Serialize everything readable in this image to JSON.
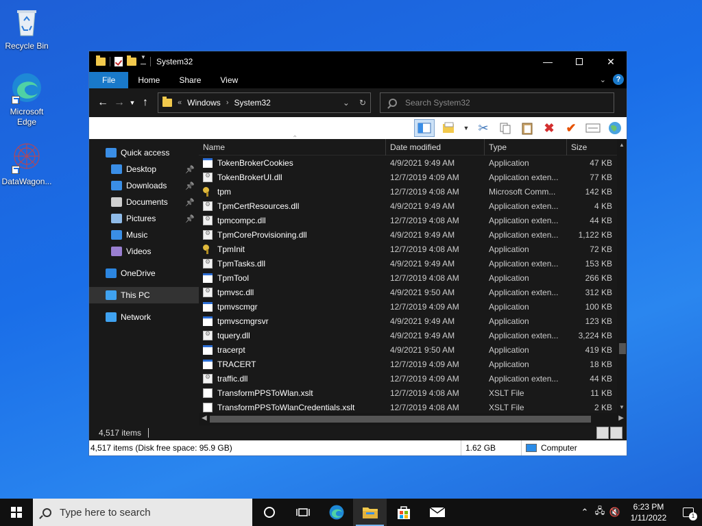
{
  "desktop": {
    "icons": [
      {
        "label": "Recycle Bin"
      },
      {
        "label": "Microsoft Edge"
      },
      {
        "label": "DataWagon..."
      }
    ]
  },
  "window": {
    "title": "System32",
    "ribbon_tabs": [
      "File",
      "Home",
      "Share",
      "View"
    ],
    "address": {
      "crumbs": [
        "Windows",
        "System32"
      ],
      "overflow": "«"
    },
    "search_placeholder": "Search System32",
    "columns": [
      "Name",
      "Date modified",
      "Type",
      "Size"
    ],
    "files": [
      {
        "name": "TokenBrokerCookies",
        "date": "4/9/2021 9:49 AM",
        "type": "Application",
        "size": "47 KB",
        "icon": "app"
      },
      {
        "name": "TokenBrokerUI.dll",
        "date": "12/7/2019 4:09 AM",
        "type": "Application exten...",
        "size": "77 KB",
        "icon": "dll"
      },
      {
        "name": "tpm",
        "date": "12/7/2019 4:08 AM",
        "type": "Microsoft Comm...",
        "size": "142 KB",
        "icon": "key"
      },
      {
        "name": "TpmCertResources.dll",
        "date": "4/9/2021 9:49 AM",
        "type": "Application exten...",
        "size": "4 KB",
        "icon": "dll"
      },
      {
        "name": "tpmcompc.dll",
        "date": "12/7/2019 4:08 AM",
        "type": "Application exten...",
        "size": "44 KB",
        "icon": "dll"
      },
      {
        "name": "TpmCoreProvisioning.dll",
        "date": "4/9/2021 9:49 AM",
        "type": "Application exten...",
        "size": "1,122 KB",
        "icon": "dll"
      },
      {
        "name": "TpmInit",
        "date": "12/7/2019 4:08 AM",
        "type": "Application",
        "size": "72 KB",
        "icon": "key"
      },
      {
        "name": "TpmTasks.dll",
        "date": "4/9/2021 9:49 AM",
        "type": "Application exten...",
        "size": "153 KB",
        "icon": "dll"
      },
      {
        "name": "TpmTool",
        "date": "12/7/2019 4:08 AM",
        "type": "Application",
        "size": "266 KB",
        "icon": "app"
      },
      {
        "name": "tpmvsc.dll",
        "date": "4/9/2021 9:50 AM",
        "type": "Application exten...",
        "size": "312 KB",
        "icon": "dll"
      },
      {
        "name": "tpmvscmgr",
        "date": "12/7/2019 4:09 AM",
        "type": "Application",
        "size": "100 KB",
        "icon": "app"
      },
      {
        "name": "tpmvscmgrsvr",
        "date": "4/9/2021 9:49 AM",
        "type": "Application",
        "size": "123 KB",
        "icon": "app"
      },
      {
        "name": "tquery.dll",
        "date": "4/9/2021 9:49 AM",
        "type": "Application exten...",
        "size": "3,224 KB",
        "icon": "dll"
      },
      {
        "name": "tracerpt",
        "date": "4/9/2021 9:50 AM",
        "type": "Application",
        "size": "419 KB",
        "icon": "app"
      },
      {
        "name": "TRACERT",
        "date": "12/7/2019 4:09 AM",
        "type": "Application",
        "size": "18 KB",
        "icon": "app"
      },
      {
        "name": "traffic.dll",
        "date": "12/7/2019 4:09 AM",
        "type": "Application exten...",
        "size": "44 KB",
        "icon": "dll"
      },
      {
        "name": "TransformPPSToWlan.xslt",
        "date": "12/7/2019 4:08 AM",
        "type": "XSLT File",
        "size": "11 KB",
        "icon": "doc"
      },
      {
        "name": "TransformPPSToWlanCredentials.xslt",
        "date": "12/7/2019 4:08 AM",
        "type": "XSLT File",
        "size": "2 KB",
        "icon": "doc"
      }
    ],
    "nav": [
      {
        "label": "Quick access",
        "color": "#3a8ee6",
        "pinned": false,
        "indent": 0
      },
      {
        "label": "Desktop",
        "color": "#3a8ee6",
        "pinned": true,
        "indent": 1
      },
      {
        "label": "Downloads",
        "color": "#3a8ee6",
        "pinned": true,
        "indent": 1
      },
      {
        "label": "Documents",
        "color": "#cfcfcf",
        "pinned": true,
        "indent": 1
      },
      {
        "label": "Pictures",
        "color": "#8fbbe8",
        "pinned": true,
        "indent": 1
      },
      {
        "label": "Music",
        "color": "#3a8ee6",
        "pinned": false,
        "indent": 1
      },
      {
        "label": "Videos",
        "color": "#9a7fd1",
        "pinned": false,
        "indent": 1
      },
      {
        "label": "OneDrive",
        "color": "#2c86e0",
        "pinned": false,
        "indent": 0
      },
      {
        "label": "This PC",
        "color": "#3fa2f0",
        "pinned": false,
        "indent": 0,
        "selected": true
      },
      {
        "label": "Network",
        "color": "#3fa2f0",
        "pinned": false,
        "indent": 0
      }
    ],
    "status": {
      "items": "4,517 items"
    },
    "details": {
      "summary": "4,517 items (Disk free space: 95.9 GB)",
      "size": "1.62 GB",
      "location": "Computer"
    }
  },
  "taskbar": {
    "search_placeholder": "Type here to search",
    "time": "6:23 PM",
    "date": "1/11/2022",
    "notification_count": "1"
  }
}
